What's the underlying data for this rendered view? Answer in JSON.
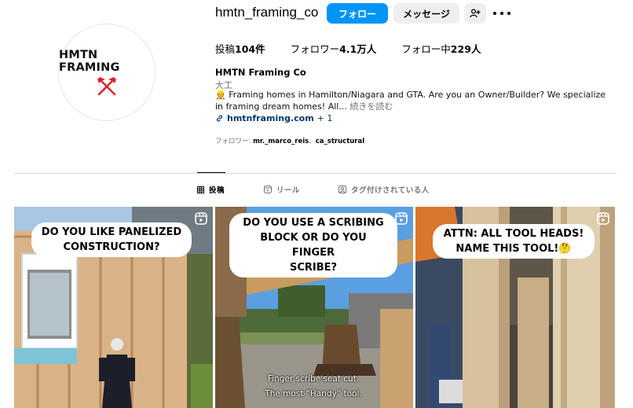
{
  "profile": {
    "username": "hmtn_framing_co",
    "follow_label": "フォロー",
    "message_label": "メッセージ",
    "avatar_logo_text": "HMTN FRAMING",
    "posts_label": "投稿",
    "posts_count": "104件",
    "followers_label": "フォロワー",
    "followers_count": "4.1万人",
    "following_label": "フォロー中",
    "following_count": "229人",
    "full_name": "HMTN Framing Co",
    "category": "大工",
    "bio_icon": "👷",
    "bio": "Framing homes in Hamilton/Niagara and GTA. Are you an Owner/Builder? We specialize in framing dream homes! All...",
    "bio_more": "続きを読む",
    "link_text": "hmtnframing.com",
    "link_extra": "+ 1",
    "followed_by_label": "フォロワー: ",
    "followed_by_user1": "mr._marco_reis",
    "followed_by_sep": "、",
    "followed_by_user2": "ca_structural"
  },
  "tabs": [
    {
      "label": "投稿",
      "icon": "grid-icon",
      "active": true
    },
    {
      "label": "リール",
      "icon": "reels-icon",
      "active": false
    },
    {
      "label": "タグ付けされている人",
      "icon": "tagged-icon",
      "active": false
    }
  ],
  "posts": [
    {
      "caption_line1": "DO YOU LIKE PANELIZED",
      "caption_line2": "CONSTRUCTION?",
      "type": "reel"
    },
    {
      "caption_line1": "DO YOU USE A SCRIBING",
      "caption_line2": "BLOCK OR DO YOU FINGER",
      "caption_line3": "SCRIBE?",
      "subtitle_line1": "Finger scribe seat cut.",
      "subtitle_line2": "The most “Handy” tool.",
      "type": "reel"
    },
    {
      "caption_line1": "ATTN: ALL TOOL HEADS!",
      "caption_line2": "NAME THIS TOOL!🤔",
      "type": "reel"
    }
  ],
  "colors": {
    "follow_button": "#0095f6",
    "secondary_button": "#efefef",
    "link": "#00376b",
    "logo_red": "#d9262c"
  }
}
